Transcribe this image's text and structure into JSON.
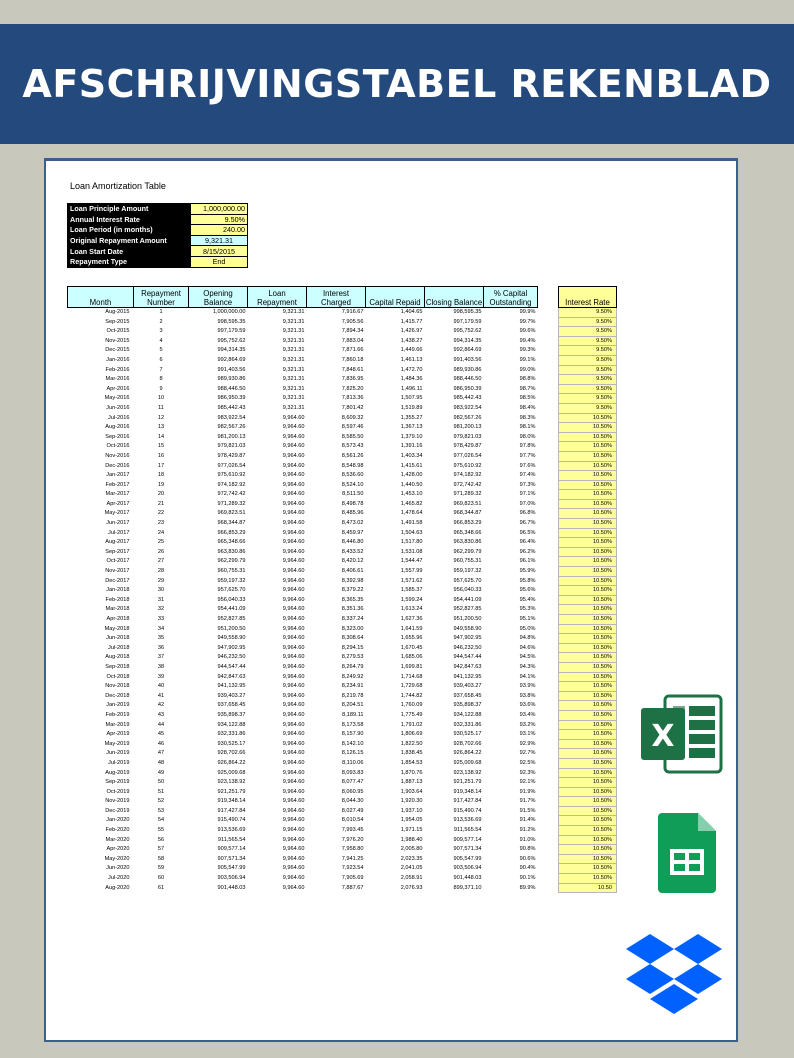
{
  "banner": {
    "title": "AFSCHRIJVINGSTABEL REKENBLAD"
  },
  "sheet": {
    "title": "Loan Amortization Table"
  },
  "params": [
    {
      "label": "Loan Principle Amount",
      "value": "1,000,000.00"
    },
    {
      "label": "Annual Interest Rate",
      "value": "9.50%"
    },
    {
      "label": "Loan Period (in months)",
      "value": "240.00"
    },
    {
      "label": "Original Repayment Amount",
      "value": "9,321.31"
    },
    {
      "label": "Loan Start Date",
      "value": "8/15/2015"
    },
    {
      "label": "Repayment Type",
      "value": "End"
    }
  ],
  "table": {
    "headers": [
      "Month",
      "Repayment Number",
      "Opening Balance",
      "Loan Repayment",
      "Interest Charged",
      "Capital Repaid",
      "Closing Balance",
      "% Capital Outstanding"
    ],
    "rate_header": "Interest Rate",
    "rows": [
      [
        "Aug-2015",
        "1",
        "1,000,000.00",
        "9,321.31",
        "7,916.67",
        "1,404.65",
        "998,595.35",
        "99.9%",
        "9.50%"
      ],
      [
        "Sep-2015",
        "2",
        "998,595.35",
        "9,321.31",
        "7,905.56",
        "1,415.77",
        "997,179.59",
        "99.7%",
        "9.50%"
      ],
      [
        "Oct-2015",
        "3",
        "997,179.59",
        "9,321.31",
        "7,894.34",
        "1,426.97",
        "995,752.62",
        "99.6%",
        "9.50%"
      ],
      [
        "Nov-2015",
        "4",
        "995,752.62",
        "9,321.31",
        "7,883.04",
        "1,438.27",
        "994,314.35",
        "99.4%",
        "9.50%"
      ],
      [
        "Dec-2015",
        "5",
        "994,314.35",
        "9,321.31",
        "7,871.66",
        "1,449.66",
        "992,864.69",
        "99.3%",
        "9.50%"
      ],
      [
        "Jan-2016",
        "6",
        "992,864.69",
        "9,321.31",
        "7,860.18",
        "1,461.13",
        "991,403.56",
        "99.1%",
        "9.50%"
      ],
      [
        "Feb-2016",
        "7",
        "991,403.56",
        "9,321.31",
        "7,848.61",
        "1,472.70",
        "989,930.86",
        "99.0%",
        "9.50%"
      ],
      [
        "Mar-2016",
        "8",
        "989,930.86",
        "9,321.31",
        "7,836.95",
        "1,484.36",
        "988,446.50",
        "98.8%",
        "9.50%"
      ],
      [
        "Apr-2016",
        "9",
        "988,446.50",
        "9,321.31",
        "7,825.20",
        "1,496.11",
        "986,950.39",
        "98.7%",
        "9.50%"
      ],
      [
        "May-2016",
        "10",
        "986,950.39",
        "9,321.31",
        "7,813.36",
        "1,507.95",
        "985,442.43",
        "98.5%",
        "9.50%"
      ],
      [
        "Jun-2016",
        "11",
        "985,442.43",
        "9,321.31",
        "7,801.42",
        "1,519.89",
        "983,922.54",
        "98.4%",
        "9.50%"
      ],
      [
        "Jul-2016",
        "12",
        "983,922.54",
        "9,964.60",
        "8,609.32",
        "1,355.27",
        "982,567.26",
        "98.3%",
        "10.50%"
      ],
      [
        "Aug-2016",
        "13",
        "982,567.26",
        "9,964.60",
        "8,597.46",
        "1,367.13",
        "981,200.13",
        "98.1%",
        "10.50%"
      ],
      [
        "Sep-2016",
        "14",
        "981,200.13",
        "9,964.60",
        "8,585.50",
        "1,379.10",
        "979,821.03",
        "98.0%",
        "10.50%"
      ],
      [
        "Oct-2016",
        "15",
        "979,821.03",
        "9,964.60",
        "8,573.43",
        "1,391.16",
        "978,429.87",
        "97.8%",
        "10.50%"
      ],
      [
        "Nov-2016",
        "16",
        "978,429.87",
        "9,964.60",
        "8,561.26",
        "1,403.34",
        "977,026.54",
        "97.7%",
        "10.50%"
      ],
      [
        "Dec-2016",
        "17",
        "977,026.54",
        "9,964.60",
        "8,548.98",
        "1,415.61",
        "975,610.92",
        "97.6%",
        "10.50%"
      ],
      [
        "Jan-2017",
        "18",
        "975,610.92",
        "9,964.60",
        "8,536.60",
        "1,428.00",
        "974,182.92",
        "97.4%",
        "10.50%"
      ],
      [
        "Feb-2017",
        "19",
        "974,182.92",
        "9,964.60",
        "8,524.10",
        "1,440.50",
        "972,742.42",
        "97.3%",
        "10.50%"
      ],
      [
        "Mar-2017",
        "20",
        "972,742.42",
        "9,964.60",
        "8,511.50",
        "1,453.10",
        "971,289.32",
        "97.1%",
        "10.50%"
      ],
      [
        "Apr-2017",
        "21",
        "971,289.32",
        "9,964.60",
        "8,498.78",
        "1,465.82",
        "969,823.51",
        "97.0%",
        "10.50%"
      ],
      [
        "May-2017",
        "22",
        "969,823.51",
        "9,964.60",
        "8,485.96",
        "1,478.64",
        "968,344.87",
        "96.8%",
        "10.50%"
      ],
      [
        "Jun-2017",
        "23",
        "968,344.87",
        "9,964.60",
        "8,473.02",
        "1,491.58",
        "966,853.29",
        "96.7%",
        "10.50%"
      ],
      [
        "Jul-2017",
        "24",
        "966,853.29",
        "9,964.60",
        "8,459.97",
        "1,504.63",
        "965,348.66",
        "96.5%",
        "10.50%"
      ],
      [
        "Aug-2017",
        "25",
        "965,348.66",
        "9,964.60",
        "8,446.80",
        "1,517.80",
        "963,830.86",
        "96.4%",
        "10.50%"
      ],
      [
        "Sep-2017",
        "26",
        "963,830.86",
        "9,964.60",
        "8,433.52",
        "1,531.08",
        "962,299.79",
        "96.2%",
        "10.50%"
      ],
      [
        "Oct-2017",
        "27",
        "962,299.79",
        "9,964.60",
        "8,420.12",
        "1,544.47",
        "960,755.31",
        "96.1%",
        "10.50%"
      ],
      [
        "Nov-2017",
        "28",
        "960,755.31",
        "9,964.60",
        "8,406.61",
        "1,557.99",
        "959,197.32",
        "95.9%",
        "10.50%"
      ],
      [
        "Dec-2017",
        "29",
        "959,197.32",
        "9,964.60",
        "8,392.98",
        "1,571.62",
        "957,625.70",
        "95.8%",
        "10.50%"
      ],
      [
        "Jan-2018",
        "30",
        "957,625.70",
        "9,964.60",
        "8,379.22",
        "1,585.37",
        "956,040.33",
        "95.6%",
        "10.50%"
      ],
      [
        "Feb-2018",
        "31",
        "956,040.33",
        "9,964.60",
        "8,365.35",
        "1,599.24",
        "954,441.09",
        "95.4%",
        "10.50%"
      ],
      [
        "Mar-2018",
        "32",
        "954,441.09",
        "9,964.60",
        "8,351.36",
        "1,613.24",
        "952,827.85",
        "95.3%",
        "10.50%"
      ],
      [
        "Apr-2018",
        "33",
        "952,827.85",
        "9,964.60",
        "8,337.24",
        "1,627.36",
        "951,200.50",
        "95.1%",
        "10.50%"
      ],
      [
        "May-2018",
        "34",
        "951,200.50",
        "9,964.60",
        "8,323.00",
        "1,641.59",
        "949,558.90",
        "95.0%",
        "10.50%"
      ],
      [
        "Jun-2018",
        "35",
        "949,558.90",
        "9,964.60",
        "8,308.64",
        "1,655.96",
        "947,902.95",
        "94.8%",
        "10.50%"
      ],
      [
        "Jul-2018",
        "36",
        "947,902.95",
        "9,964.60",
        "8,294.15",
        "1,670.45",
        "946,232.50",
        "94.6%",
        "10.50%"
      ],
      [
        "Aug-2018",
        "37",
        "946,232.50",
        "9,964.60",
        "8,279.53",
        "1,685.06",
        "944,547.44",
        "94.5%",
        "10.50%"
      ],
      [
        "Sep-2018",
        "38",
        "944,547.44",
        "9,964.60",
        "8,264.79",
        "1,699.81",
        "942,847.63",
        "94.3%",
        "10.50%"
      ],
      [
        "Oct-2018",
        "39",
        "942,847.63",
        "9,964.60",
        "8,249.92",
        "1,714.68",
        "941,132.95",
        "94.1%",
        "10.50%"
      ],
      [
        "Nov-2018",
        "40",
        "941,132.95",
        "9,964.60",
        "8,234.91",
        "1,729.68",
        "939,403.27",
        "93.9%",
        "10.50%"
      ],
      [
        "Dec-2018",
        "41",
        "939,403.27",
        "9,964.60",
        "8,219.78",
        "1,744.82",
        "937,658.45",
        "93.8%",
        "10.50%"
      ],
      [
        "Jan-2019",
        "42",
        "937,658.45",
        "9,964.60",
        "8,204.51",
        "1,760.09",
        "935,898.37",
        "93.6%",
        "10.50%"
      ],
      [
        "Feb-2019",
        "43",
        "935,898.37",
        "9,964.60",
        "8,189.11",
        "1,775.49",
        "934,122.88",
        "93.4%",
        "10.50%"
      ],
      [
        "Mar-2019",
        "44",
        "934,122.88",
        "9,964.60",
        "8,173.58",
        "1,791.02",
        "932,331.86",
        "93.2%",
        "10.50%"
      ],
      [
        "Apr-2019",
        "45",
        "932,331.86",
        "9,964.60",
        "8,157.90",
        "1,806.69",
        "930,525.17",
        "93.1%",
        "10.50%"
      ],
      [
        "May-2019",
        "46",
        "930,525.17",
        "9,964.60",
        "8,142.10",
        "1,822.50",
        "928,702.66",
        "92.9%",
        "10.50%"
      ],
      [
        "Jun-2019",
        "47",
        "928,702.66",
        "9,964.60",
        "8,126.15",
        "1,838.45",
        "926,864.22",
        "92.7%",
        "10.50%"
      ],
      [
        "Jul-2019",
        "48",
        "926,864.22",
        "9,964.60",
        "8,110.06",
        "1,854.53",
        "925,009.68",
        "92.5%",
        "10.50%"
      ],
      [
        "Aug-2019",
        "49",
        "925,009.68",
        "9,964.60",
        "8,093.83",
        "1,870.76",
        "923,138.92",
        "92.3%",
        "10.50%"
      ],
      [
        "Sep-2019",
        "50",
        "923,138.92",
        "9,964.60",
        "8,077.47",
        "1,887.13",
        "921,251.79",
        "92.1%",
        "10.50%"
      ],
      [
        "Oct-2019",
        "51",
        "921,251.79",
        "9,964.60",
        "8,060.95",
        "1,903.64",
        "919,348.14",
        "91.9%",
        "10.50%"
      ],
      [
        "Nov-2019",
        "52",
        "919,348.14",
        "9,964.60",
        "8,044.30",
        "1,920.30",
        "917,427.84",
        "91.7%",
        "10.50%"
      ],
      [
        "Dec-2019",
        "53",
        "917,427.84",
        "9,964.60",
        "8,027.49",
        "1,937.10",
        "915,490.74",
        "91.5%",
        "10.50%"
      ],
      [
        "Jan-2020",
        "54",
        "915,490.74",
        "9,964.60",
        "8,010.54",
        "1,954.05",
        "913,536.69",
        "91.4%",
        "10.50%"
      ],
      [
        "Feb-2020",
        "55",
        "913,536.69",
        "9,964.60",
        "7,993.45",
        "1,971.15",
        "911,565.54",
        "91.2%",
        "10.50%"
      ],
      [
        "Mar-2020",
        "56",
        "911,565.54",
        "9,964.60",
        "7,976.20",
        "1,988.40",
        "909,577.14",
        "91.0%",
        "10.50%"
      ],
      [
        "Apr-2020",
        "57",
        "909,577.14",
        "9,964.60",
        "7,958.80",
        "2,005.80",
        "907,571.34",
        "90.8%",
        "10.50%"
      ],
      [
        "May-2020",
        "58",
        "907,571.34",
        "9,964.60",
        "7,941.25",
        "2,023.35",
        "905,547.99",
        "90.6%",
        "10.50%"
      ],
      [
        "Jun-2020",
        "59",
        "905,547.99",
        "9,964.60",
        "7,923.54",
        "2,041.05",
        "903,506.94",
        "90.4%",
        "10.50%"
      ],
      [
        "Jul-2020",
        "60",
        "903,506.94",
        "9,964.60",
        "7,905.69",
        "2,058.91",
        "901,448.03",
        "90.1%",
        "10.50%"
      ],
      [
        "Aug-2020",
        "61",
        "901,448.03",
        "9,964.60",
        "7,887.67",
        "2,076.93",
        "899,371.10",
        "89.9%",
        "10.50"
      ]
    ]
  },
  "icons": {
    "excel": {
      "name": "excel-icon",
      "letter": "X",
      "color": "#1e7145"
    },
    "sheets": {
      "name": "google-sheets-icon",
      "color": "#0f9d58"
    },
    "dropbox": {
      "name": "dropbox-icon",
      "color": "#0061fe"
    }
  }
}
